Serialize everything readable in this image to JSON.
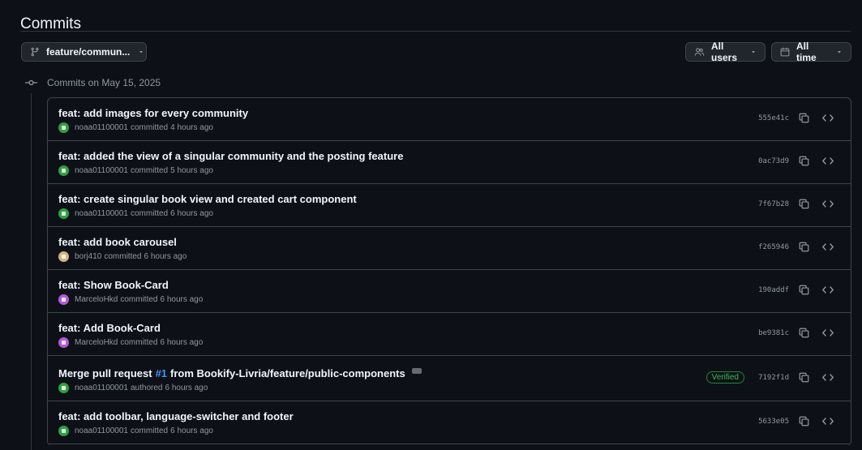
{
  "header": {
    "title": "Commits"
  },
  "filters": {
    "branch": {
      "label": "feature/commun...",
      "icon": "git-branch-icon"
    },
    "users": {
      "label": "All users",
      "icon": "people-icon"
    },
    "time": {
      "label": "All time",
      "icon": "calendar-icon"
    }
  },
  "day_group": {
    "heading": "Commits on May 15, 2025"
  },
  "colors": {
    "background": "#0d1117",
    "border": "#3d444d",
    "link": "#4493f8",
    "verified": "#3fb950"
  },
  "commits": [
    {
      "message": "feat: add images for every community",
      "author": "noaa01100001",
      "action": "committed",
      "time": "4 hours ago",
      "sha": "555e41c",
      "avatar_color": "#2ea043"
    },
    {
      "message": "feat: added the view of a singular community and the posting feature",
      "author": "noaa01100001",
      "action": "committed",
      "time": "5 hours ago",
      "sha": "0ac73d9",
      "avatar_color": "#2ea043"
    },
    {
      "message": "feat: create singular book view and created cart component",
      "author": "noaa01100001",
      "action": "committed",
      "time": "6 hours ago",
      "sha": "7f67b28",
      "avatar_color": "#2ea043"
    },
    {
      "message": "feat: add book carousel",
      "author": "borj410",
      "action": "committed",
      "time": "6 hours ago",
      "sha": "f265946",
      "avatar_color": "#d4b483"
    },
    {
      "message": "feat: Show Book-Card",
      "author": "MarceloHkd",
      "action": "committed",
      "time": "6 hours ago",
      "sha": "190addf",
      "avatar_color": "#b45ad4"
    },
    {
      "message": "feat: Add Book-Card",
      "author": "MarceloHkd",
      "action": "committed",
      "time": "6 hours ago",
      "sha": "be9381c",
      "avatar_color": "#b45ad4"
    },
    {
      "message_prefix": "Merge pull request",
      "pr_link": "#1",
      "message_suffix": "from Bookify-Livria/feature/public-components",
      "author": "noaa01100001",
      "action": "authored",
      "time": "6 hours ago",
      "sha": "7192f1d",
      "badge": "Verified",
      "avatar_color": "#2ea043"
    },
    {
      "message": "feat: add toolbar, language-switcher and footer",
      "author": "noaa01100001",
      "action": "committed",
      "time": "6 hours ago",
      "sha": "5633e05",
      "avatar_color": "#2ea043"
    }
  ]
}
